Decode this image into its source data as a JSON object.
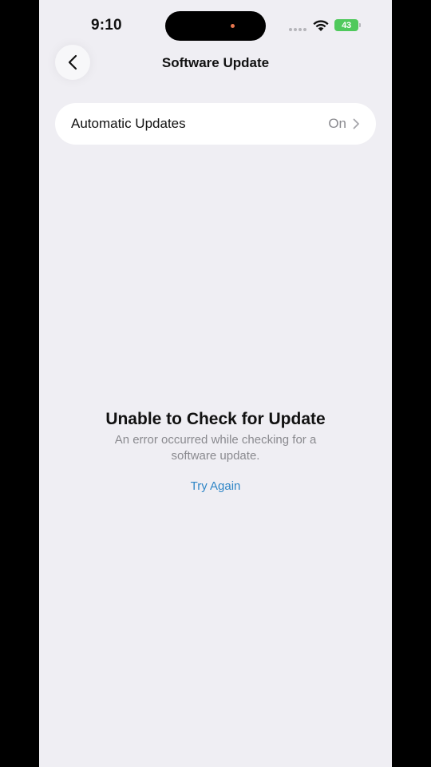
{
  "status_bar": {
    "time": "9:10",
    "battery": "43",
    "icons": [
      "signal-icon",
      "wifi-icon",
      "battery-icon"
    ]
  },
  "nav": {
    "title": "Software Update",
    "back_icon": "chevron-left-icon"
  },
  "settings": {
    "automatic_updates": {
      "label": "Automatic Updates",
      "value": "On",
      "icon": "chevron-right-icon"
    }
  },
  "error": {
    "title": "Unable to Check for Update",
    "message": "An error occurred while checking for a software update.",
    "retry_label": "Try Again"
  },
  "colors": {
    "background": "#efeef3",
    "card": "#ffffff",
    "link": "#2f86c6",
    "secondary_text": "#8a8a8f",
    "battery": "#4fc95c"
  }
}
